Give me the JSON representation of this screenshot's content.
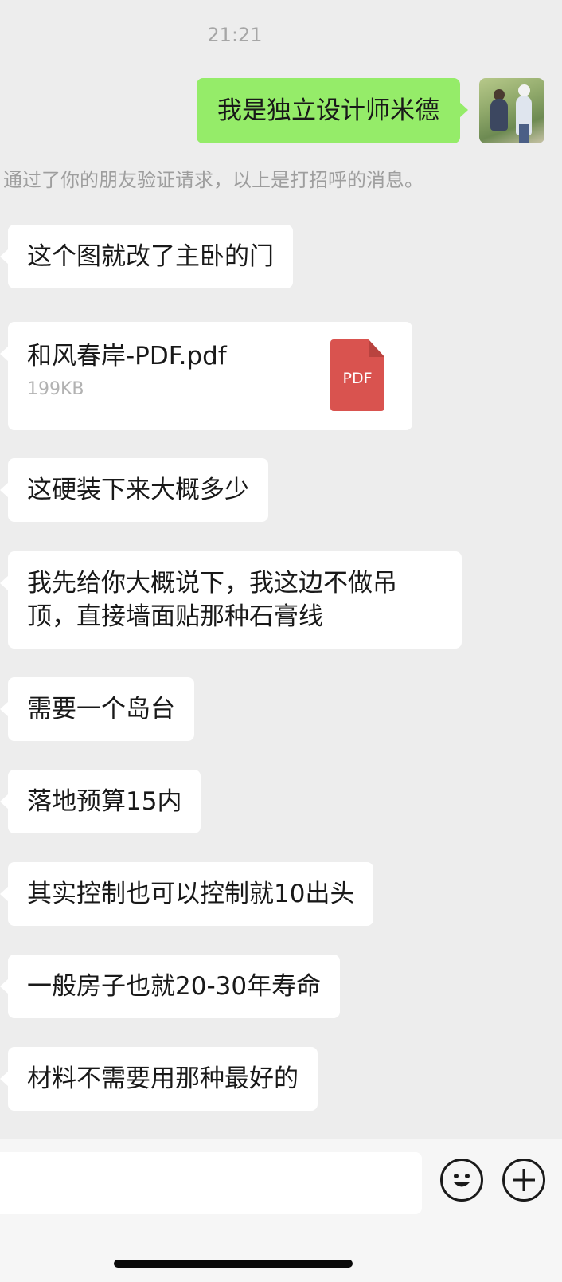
{
  "chat": {
    "timestamp": "21:21",
    "sent_message": "我是独立设计师米德",
    "system_notice": "通过了你的朋友验证请求，以上是打招呼的消息。",
    "received": [
      "这个图就改了主卧的门",
      "这硬装下来大概多少",
      "我先给你大概说下，我这边不做吊",
      "顶，直接墙面贴那种石膏线",
      "需要一个岛台",
      "落地预算15内",
      "其实控制也可以控制就10出头",
      "一般房子也就20-30年寿命",
      "材料不需要用那种最好的"
    ],
    "file": {
      "name": "和风春岸-PDF.pdf",
      "size": "199KB",
      "icon_label": "PDF",
      "icon": "pdf-file-icon"
    }
  },
  "input_bar": {
    "emoji_icon": "emoji-icon",
    "plus_icon": "plus-circle-icon"
  },
  "colors": {
    "background": "#ededed",
    "sent_bubble": "#95ec69",
    "received_bubble": "#ffffff",
    "pdf_red": "#d9534f"
  }
}
